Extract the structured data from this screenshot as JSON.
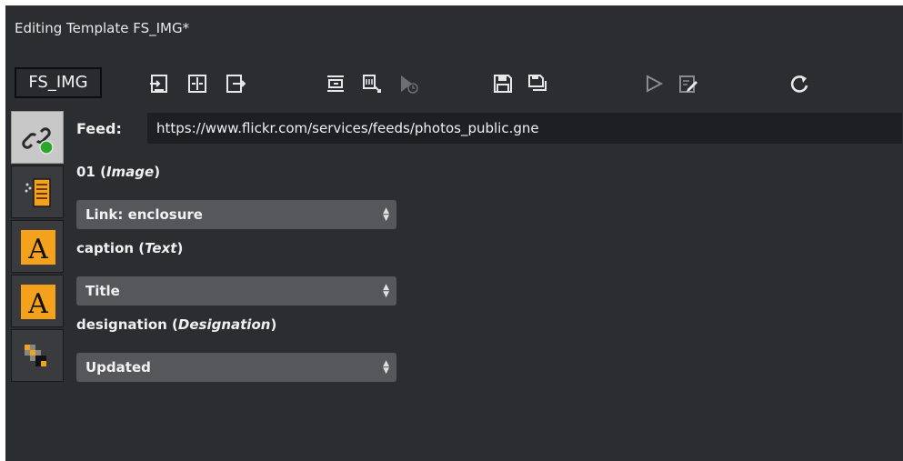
{
  "window": {
    "title": "Editing Template FS_IMG*"
  },
  "toolbar": {
    "template_name": "FS_IMG",
    "icons": [
      "import-icon",
      "split-icon",
      "export-icon",
      "insert-field-icon",
      "manage-fields-icon",
      "schedule-icon",
      "save-icon",
      "save-as-icon",
      "play-icon",
      "edit-icon",
      "refresh-icon"
    ]
  },
  "sidebar": {
    "items": [
      {
        "name": "feed-link-icon",
        "active": true
      },
      {
        "name": "image-field-icon",
        "active": false
      },
      {
        "name": "text-field-icon",
        "active": false
      },
      {
        "name": "text-field-icon",
        "active": false
      },
      {
        "name": "designation-field-icon",
        "active": false
      }
    ]
  },
  "feed": {
    "label": "Feed:",
    "url": "https://www.flickr.com/services/feeds/photos_public.gne"
  },
  "fields": [
    {
      "name": "01",
      "open": " (",
      "type": "Image",
      "close": ")",
      "value": "Link: enclosure"
    },
    {
      "name": "caption",
      "open": " (",
      "type": "Text",
      "close": ")",
      "value": "Title"
    },
    {
      "name": "designation",
      "open": " (",
      "type": "Designation",
      "close": ")",
      "value": "Updated"
    }
  ],
  "colors": {
    "panel": "#2c2d30",
    "input": "#1e1f22",
    "select": "#56575b",
    "accent_orange": "#f4a21c"
  }
}
